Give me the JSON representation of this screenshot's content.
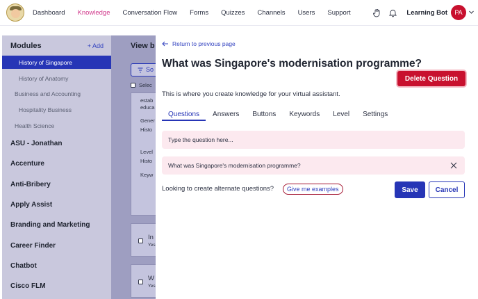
{
  "nav": {
    "items": [
      "Dashboard",
      "Knowledge",
      "Conversation Flow",
      "Forms",
      "Quizzes",
      "Channels",
      "Users",
      "Support"
    ],
    "active_index": 1,
    "user_name": "Learning Bot",
    "avatar_initials": "PA"
  },
  "sidebar": {
    "header": "Modules",
    "add_label": "+ Add",
    "items": [
      {
        "label": "History of Singapore",
        "level": "sub",
        "selected": true
      },
      {
        "label": "History of Anatomy",
        "level": "sub"
      },
      {
        "label": "Business and Accounting",
        "level": "sub"
      },
      {
        "label": "Hospitality Business",
        "level": "sub"
      },
      {
        "label": "Health Science",
        "level": "sub"
      },
      {
        "label": "ASU - Jonathan",
        "level": "top"
      },
      {
        "label": "Accenture",
        "level": "top"
      },
      {
        "label": "Anti-Bribery",
        "level": "top"
      },
      {
        "label": "Apply Assist",
        "level": "top"
      },
      {
        "label": "Branding and Marketing",
        "level": "top"
      },
      {
        "label": "Career Finder",
        "level": "top"
      },
      {
        "label": "Chatbot",
        "level": "top"
      },
      {
        "label": "Cisco FLM",
        "level": "top"
      }
    ]
  },
  "middle": {
    "title_fragment": "View b",
    "select_fragment": "Selec",
    "card_lines": [
      "estab",
      "educa",
      "Gener",
      "Histo",
      "Level",
      "Histo",
      "Keyw"
    ],
    "row_fragments": [
      {
        "title": "In",
        "sub": "Yes"
      },
      {
        "title": "W",
        "sub": "Yes"
      }
    ]
  },
  "panel": {
    "back_label": "Return to previous page",
    "title": "What was Singapore's modernisation programme?",
    "delete_label": "Delete Question",
    "description": "This is where you create knowledge for your virtual assistant.",
    "tabs": [
      "Questions",
      "Answers",
      "Buttons",
      "Keywords",
      "Level",
      "Settings"
    ],
    "active_tab": 0,
    "input_placeholder": "Type the question here...",
    "questions": [
      "What was Singapore's modernisation programme?"
    ],
    "alternate_prompt": "Looking to create alternate questions?",
    "examples_label": "Give me examples",
    "save_label": "Save",
    "cancel_label": "Cancel"
  },
  "colors": {
    "accent": "#2635b6",
    "danger": "#c8102e",
    "nav_active": "#d13a8c",
    "question_bg": "#fce9ef"
  },
  "icons": [
    "logo-avatar",
    "hand-icon",
    "bell-icon",
    "chevron-down-icon",
    "arrow-left-icon",
    "filter-icon",
    "close-icon"
  ]
}
